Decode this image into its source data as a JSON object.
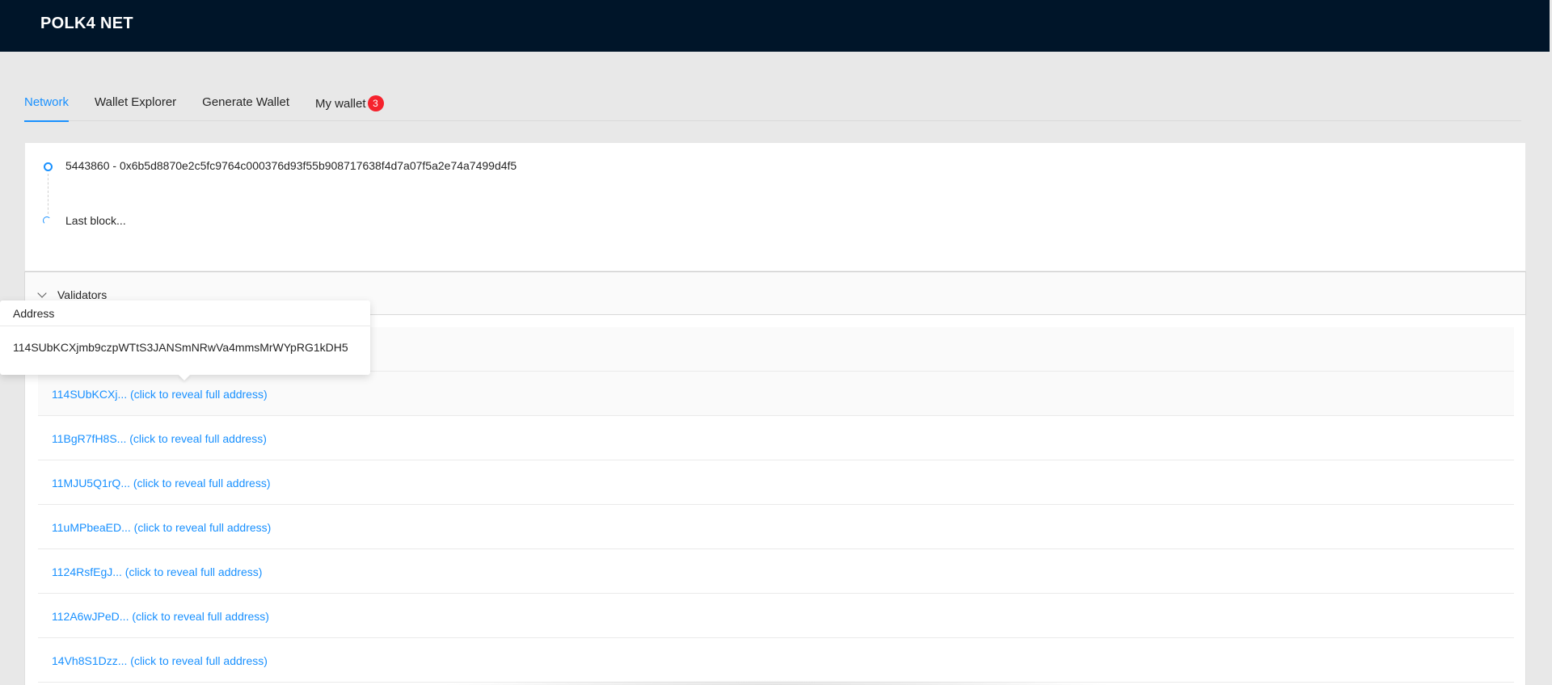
{
  "app": {
    "title": "POLK4 NET"
  },
  "tabs": [
    {
      "label": "Network",
      "active": true
    },
    {
      "label": "Wallet Explorer"
    },
    {
      "label": "Generate Wallet"
    },
    {
      "label": "My wallet",
      "badge": "3"
    }
  ],
  "timeline": {
    "block": "5443860 - 0x6b5d8870e2c5fc9764c000376d93f55b908717638f4d7a07f5a2e74a7499d4f5",
    "pending": "Last block..."
  },
  "validators": {
    "header": "Validators",
    "rows": [
      "",
      "114SUbKCXj... (click to reveal full address)",
      "11BgR7fH8S... (click to reveal full address)",
      "11MJU5Q1rQ... (click to reveal full address)",
      "11uMPbeaED... (click to reveal full address)",
      "1124RsfEgJ... (click to reveal full address)",
      "112A6wJPeD... (click to reveal full address)",
      "14Vh8S1Dzz... (click to reveal full address)"
    ]
  },
  "popover": {
    "title": "Address",
    "content": "114SUbKCXjmb9czpWTtS3JANSmNRwVa4mmsMrWYpRG1kDH5"
  },
  "colors": {
    "header_bg": "#001529",
    "accent": "#1890ff",
    "badge": "#f5222d"
  }
}
